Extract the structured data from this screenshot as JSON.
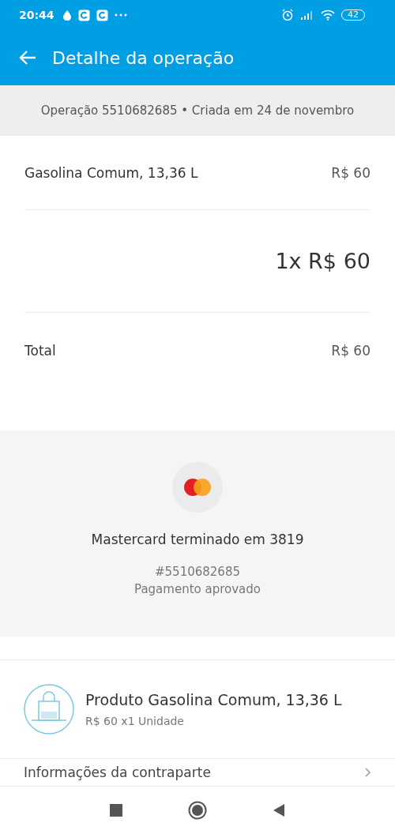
{
  "status_bar": {
    "time": "20:44",
    "battery": "42"
  },
  "header": {
    "title": "Detalhe da operação"
  },
  "operation_info": "Operação 5510682685 • Criada em 24 de novembro",
  "items": [
    {
      "name": "Gasolina Comum, 13,36 L",
      "price": "R$ 60"
    }
  ],
  "quantity_total": "1x R$ 60",
  "total": {
    "label": "Total",
    "value": "R$ 60"
  },
  "payment": {
    "card": "Mastercard terminado em 3819",
    "id": "#5510682685",
    "status": "Pagamento aprovado"
  },
  "product": {
    "title": "Produto Gasolina Comum, 13,36 L",
    "subtitle": "R$ 60 x1 Unidade"
  },
  "counterpart_link": "Informações da contraparte"
}
